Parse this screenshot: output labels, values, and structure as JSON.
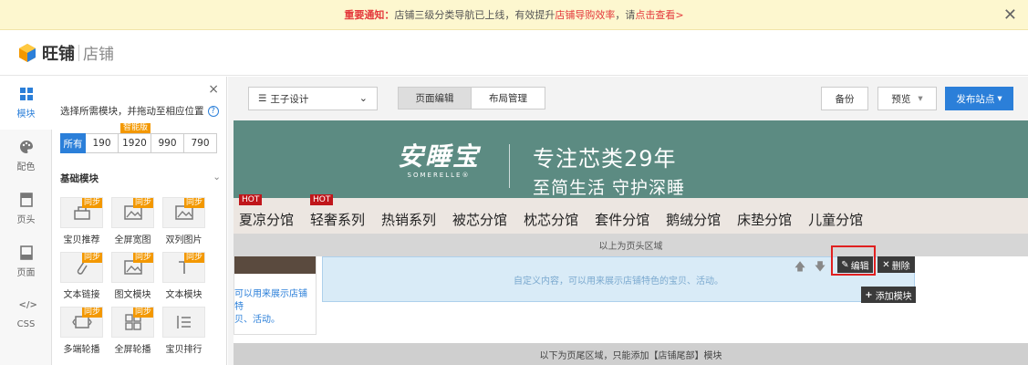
{
  "notice": {
    "prefix": "重要通知：",
    "text1": "店铺三级分类导航已上线，有效提升",
    "highlight": "店铺导购效率",
    "text2": "，请",
    "link": "点击查看>",
    "close": "✕"
  },
  "app": {
    "name": "旺铺",
    "sub": "店铺"
  },
  "rail": [
    {
      "label": "模块",
      "icon": "grid-icon"
    },
    {
      "label": "配色",
      "icon": "palette-icon"
    },
    {
      "label": "页头",
      "icon": "header-icon"
    },
    {
      "label": "页面",
      "icon": "page-icon"
    },
    {
      "label": "CSS",
      "icon": "code-icon"
    }
  ],
  "rail_css_glyph": "</>",
  "panel": {
    "close": "×",
    "hint": "选择所需模块，并拖动至相应位置",
    "help": "?",
    "filters": [
      "所有",
      "190",
      "1920",
      "990",
      "790"
    ],
    "smart_tag": "智能版",
    "section": "基础模块",
    "section_chevron": "⌄",
    "sync_tag": "同步",
    "modules": [
      {
        "label": "宝贝推荐",
        "sync": true
      },
      {
        "label": "全屏宽图",
        "sync": true
      },
      {
        "label": "双列图片",
        "sync": true
      },
      {
        "label": "文本链接",
        "sync": true
      },
      {
        "label": "图文模块",
        "sync": true
      },
      {
        "label": "文本模块",
        "sync": true
      },
      {
        "label": "多端轮播",
        "sync": true
      },
      {
        "label": "全屏轮播",
        "sync": true
      },
      {
        "label": "宝贝排行",
        "sync": false
      }
    ]
  },
  "toolbar": {
    "theme_icon": "☰",
    "theme": "王子设计",
    "theme_chevron": "⌄",
    "tab_edit": "页面编辑",
    "tab_layout": "布局管理",
    "backup": "备份",
    "preview": "预览",
    "preview_caret": "▾",
    "publish": "发布站点",
    "publish_caret": "▾"
  },
  "banner": {
    "brand": "安睡宝",
    "brand_en": "SOMERELLE®",
    "slogan1": "专注芯类29年",
    "slogan2": "至简生活 守护深睡",
    "bg": "#5c8b82"
  },
  "nav": {
    "hot_label": "HOT",
    "items": [
      {
        "label": "夏凉分馆",
        "hot": true
      },
      {
        "label": "轻奢系列",
        "hot": true
      },
      {
        "label": "热销系列",
        "hot": false
      },
      {
        "label": "被芯分馆",
        "hot": false
      },
      {
        "label": "枕芯分馆",
        "hot": false
      },
      {
        "label": "套件分馆",
        "hot": false
      },
      {
        "label": "鹅绒分馆",
        "hot": false
      },
      {
        "label": "床垫分馆",
        "hot": false
      },
      {
        "label": "儿童分馆",
        "hot": false
      }
    ]
  },
  "canvas": {
    "header_zone": "以上为页头区域",
    "left_text1": "可以用来展示店铺特",
    "left_text2": "贝、活动。",
    "custom": "自定义内容，可以用来展示店铺特色的宝贝、活动。",
    "arrow_up": "🡅",
    "arrow_down": "🡇",
    "edit_icon": "✎",
    "edit": "编辑",
    "delete_icon": "✕",
    "delete": "删除",
    "add_icon": "+",
    "add": "添加模块",
    "footer_zone": "以下为页尾区域，只能添加【店铺尾部】模块"
  }
}
